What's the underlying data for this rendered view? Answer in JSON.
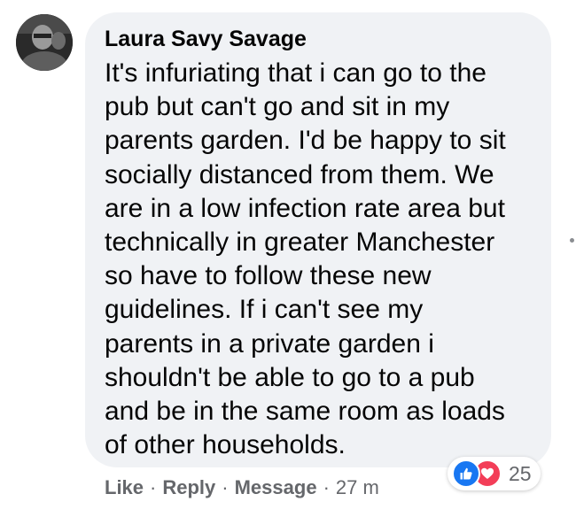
{
  "comment": {
    "author": "Laura Savy Savage",
    "text_lines": [
      "It's infuriating that i can go to the",
      "pub but can't go and sit in my",
      "parents garden. I'd be happy to sit",
      "socially distanced from them. We",
      "are in a low infection rate area but",
      "technically in greater Manchester",
      "so have to follow these new",
      "guidelines. If i can't see my",
      "parents in a private garden i",
      "shouldn't be able to go to a pub",
      "and be in the same room as loads",
      "of other households."
    ],
    "actions": {
      "like": "Like",
      "reply": "Reply",
      "message": "Message",
      "separator": "·",
      "timestamp": "27 m"
    },
    "reactions": {
      "types": [
        "like-icon",
        "love-icon"
      ],
      "count": "25"
    }
  },
  "colors": {
    "bubble": "#f0f2f5",
    "text": "#050505",
    "secondary_text": "#65676b",
    "like_blue": "#1877f2",
    "love_red": "#f33e58"
  }
}
